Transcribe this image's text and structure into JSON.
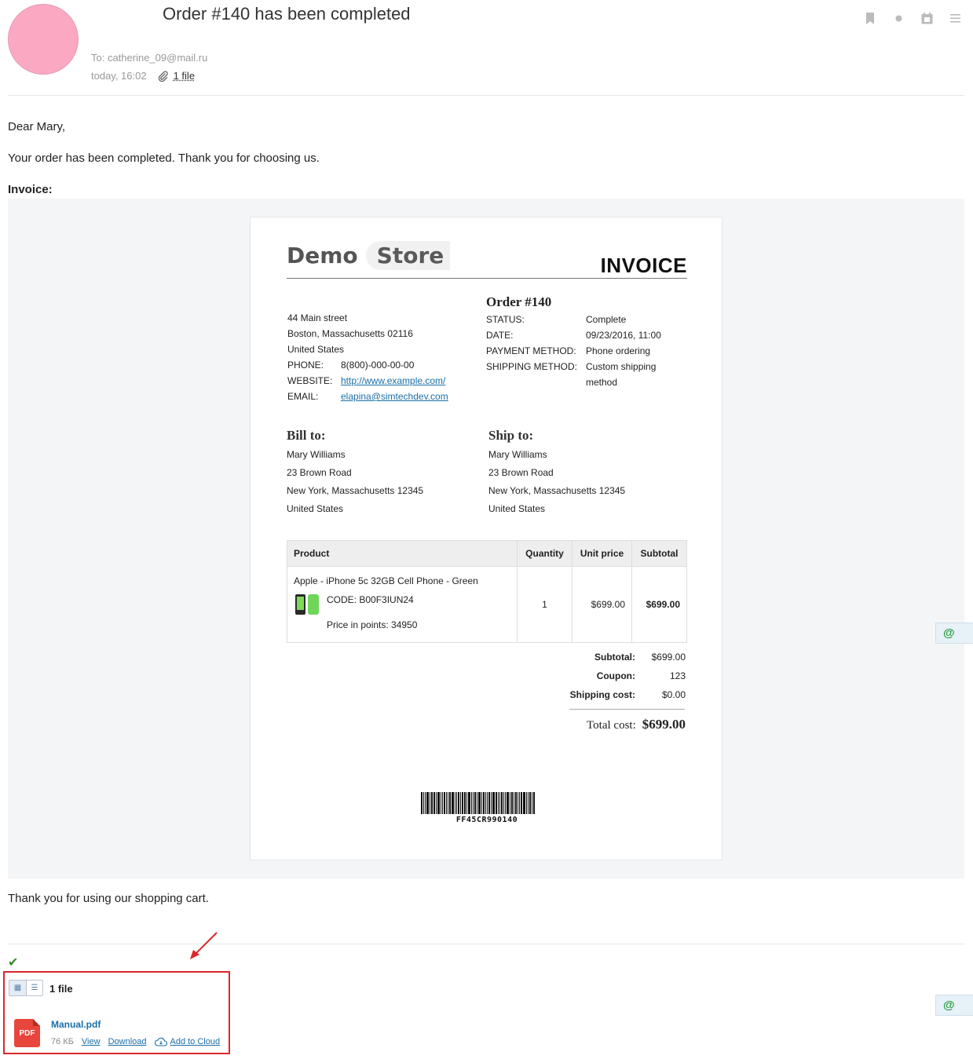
{
  "header": {
    "subject": "Order #140 has been completed",
    "to": "To: catherine_09@mail.ru",
    "date": "today, 16:02",
    "files_link": "1 file",
    "icons": [
      "bookmark-icon",
      "dot-icon",
      "calendar-icon",
      "menu-icon"
    ]
  },
  "body": {
    "greeting": "Dear Mary,",
    "message": "Your order has been completed. Thank you for choosing us.",
    "invoice_label": "Invoice:",
    "closing": "Thank you for using our shopping cart."
  },
  "invoice": {
    "logo_demo": "Demo",
    "logo_store": "Store",
    "title": "INVOICE",
    "store_address": {
      "line1": "44 Main street",
      "line2": "Boston, Massachusetts 02116",
      "line3": "United States",
      "phone_label": "PHONE:",
      "phone": "8(800)-000-00-00",
      "website_label": "WEBSITE:",
      "website": "http://www.example.com/",
      "email_label": "EMAIL:",
      "email": "elapina@simtechdev.com"
    },
    "order": {
      "title": "Order #140",
      "status_label": "STATUS:",
      "status": "Complete",
      "date_label": "DATE:",
      "date": "09/23/2016, 11:00",
      "payment_label": "PAYMENT METHOD:",
      "payment": "Phone ordering",
      "shipping_label": "SHIPPING METHOD:",
      "shipping": "Custom shipping method"
    },
    "bill_to": {
      "title": "Bill to:",
      "name": "Mary Williams",
      "street": "23 Brown Road",
      "city": "New York, Massachusetts 12345",
      "country": "United States"
    },
    "ship_to": {
      "title": "Ship to:",
      "name": "Mary Williams",
      "street": "23 Brown Road",
      "city": "New York, Massachusetts 12345",
      "country": "United States"
    },
    "table": {
      "headers": {
        "product": "Product",
        "quantity": "Quantity",
        "unit_price": "Unit price",
        "subtotal": "Subtotal"
      },
      "rows": [
        {
          "name": "Apple - iPhone 5c 32GB Cell Phone - Green",
          "code": "CODE: B00F3IUN24",
          "points": "Price in points: 34950",
          "quantity": "1",
          "unit_price": "$699.00",
          "subtotal": "$699.00"
        }
      ]
    },
    "totals": {
      "subtotal_label": "Subtotal:",
      "subtotal": "$699.00",
      "coupon_label": "Coupon:",
      "coupon": "123",
      "shipping_label": "Shipping cost:",
      "shipping": "$0.00",
      "total_label": "Total cost:",
      "total": "$699.00"
    },
    "barcode": "FF45CR990140"
  },
  "attachments": {
    "count": "1 file",
    "files": [
      {
        "name": "Manual.pdf",
        "type": "PDF",
        "size": "76 КБ",
        "view": "View",
        "download": "Download",
        "cloud": "Add to Cloud"
      }
    ]
  },
  "colors": {
    "avatar": "#fba9c3",
    "link": "#1a6ea8",
    "highlight_box": "#d9262c",
    "pdf": "#e8453c"
  }
}
